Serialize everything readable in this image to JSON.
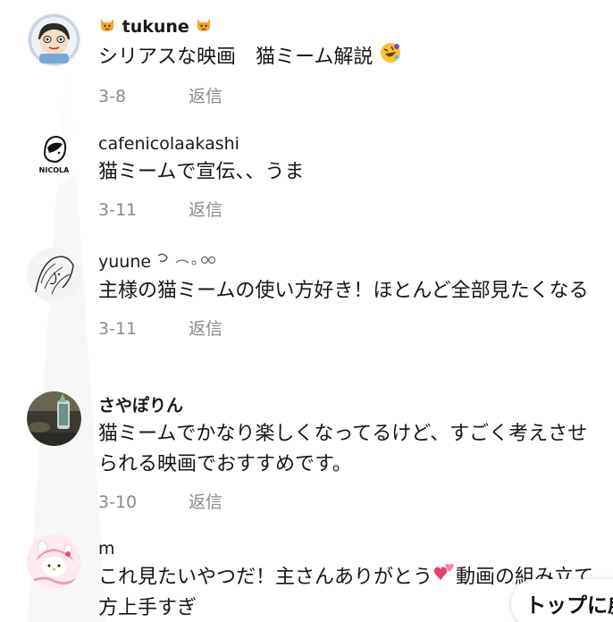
{
  "comments": [
    {
      "username": "tukune",
      "username_prefix_icon": "cat-face-emoji",
      "username_suffix_icon": "cat-face-emoji",
      "text": "シリアスな映画　猫ミーム解説",
      "text_suffix_icon": "rolling-laughing-emoji",
      "date": "3-8",
      "reply_label": "返信"
    },
    {
      "username": "cafenicolaakashi",
      "text": "猫ミームで宣伝、、うま",
      "date": "3-11",
      "reply_label": "返信"
    },
    {
      "username": "yuune",
      "username_suffix_icon": "sparkle-doodle",
      "text": "主様の猫ミームの使い方好き！ほとんど全部見たくなる",
      "date": "3-11",
      "reply_label": "返信"
    },
    {
      "username": "さやぽりん",
      "text": "猫ミームでかなり楽しくなってるけど、すごく考えさせられる映画でおすすめです。",
      "date": "3-10",
      "reply_label": "返信"
    },
    {
      "username": "m",
      "text_part1": "これ見たいやつだ！主さんありがとう",
      "text_part2": "動画の組み立て方上手すぎ",
      "text_mid_icon": "two-hearts-emoji"
    }
  ],
  "toast": {
    "label": "トップに戻る"
  },
  "colors": {
    "text": "#161616",
    "meta": "#8a8a8a",
    "background": "#ffffff"
  }
}
